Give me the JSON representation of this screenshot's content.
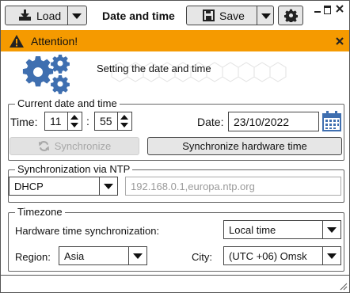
{
  "toolbar": {
    "load_label": "Load",
    "title": "Date and time",
    "save_label": "Save"
  },
  "alert": {
    "text": "Attention!",
    "color": "#f59a00"
  },
  "banner": {
    "text": "Setting the date and time"
  },
  "current": {
    "legend": "Current date and time",
    "time_label": "Time:",
    "hour": "11",
    "minute": "55",
    "separator": ":",
    "date_label": "Date:",
    "date": "23/10/2022",
    "sync_label": "Synchronize",
    "sync_hw_label": "Synchronize hardware time"
  },
  "ntp": {
    "legend": "Synchronization via NTP",
    "mode": "DHCP",
    "servers": "192.168.0.1,europa.ntp.org"
  },
  "timezone": {
    "legend": "Timezone",
    "hw_label": "Hardware time synchronization:",
    "hw_value": "Local time",
    "region_label": "Region:",
    "region_value": "Asia",
    "city_label": "City:",
    "city_value": "(UTC +06) Omsk"
  },
  "icons": {
    "load": "download-icon",
    "save": "floppy-disk-icon",
    "settings": "gear-icon",
    "calendar": "calendar-icon",
    "sync": "refresh-icon",
    "warning": "warning-icon"
  }
}
